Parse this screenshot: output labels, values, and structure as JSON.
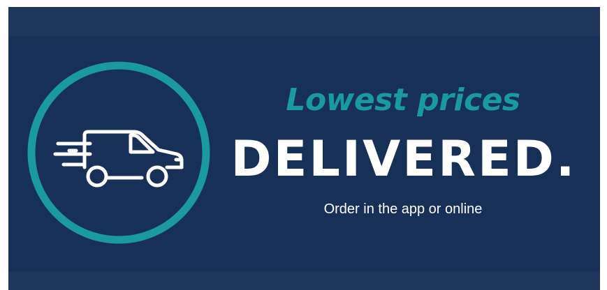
{
  "banner": {
    "tagline": "Lowest prices",
    "headline": "DELIVERED.",
    "subline": "Order in the app or online",
    "icon": "delivery-van-icon"
  },
  "colors": {
    "background": "#173057",
    "band": "#1e3659",
    "accent": "#1a9aa0",
    "text": "#ffffff"
  }
}
